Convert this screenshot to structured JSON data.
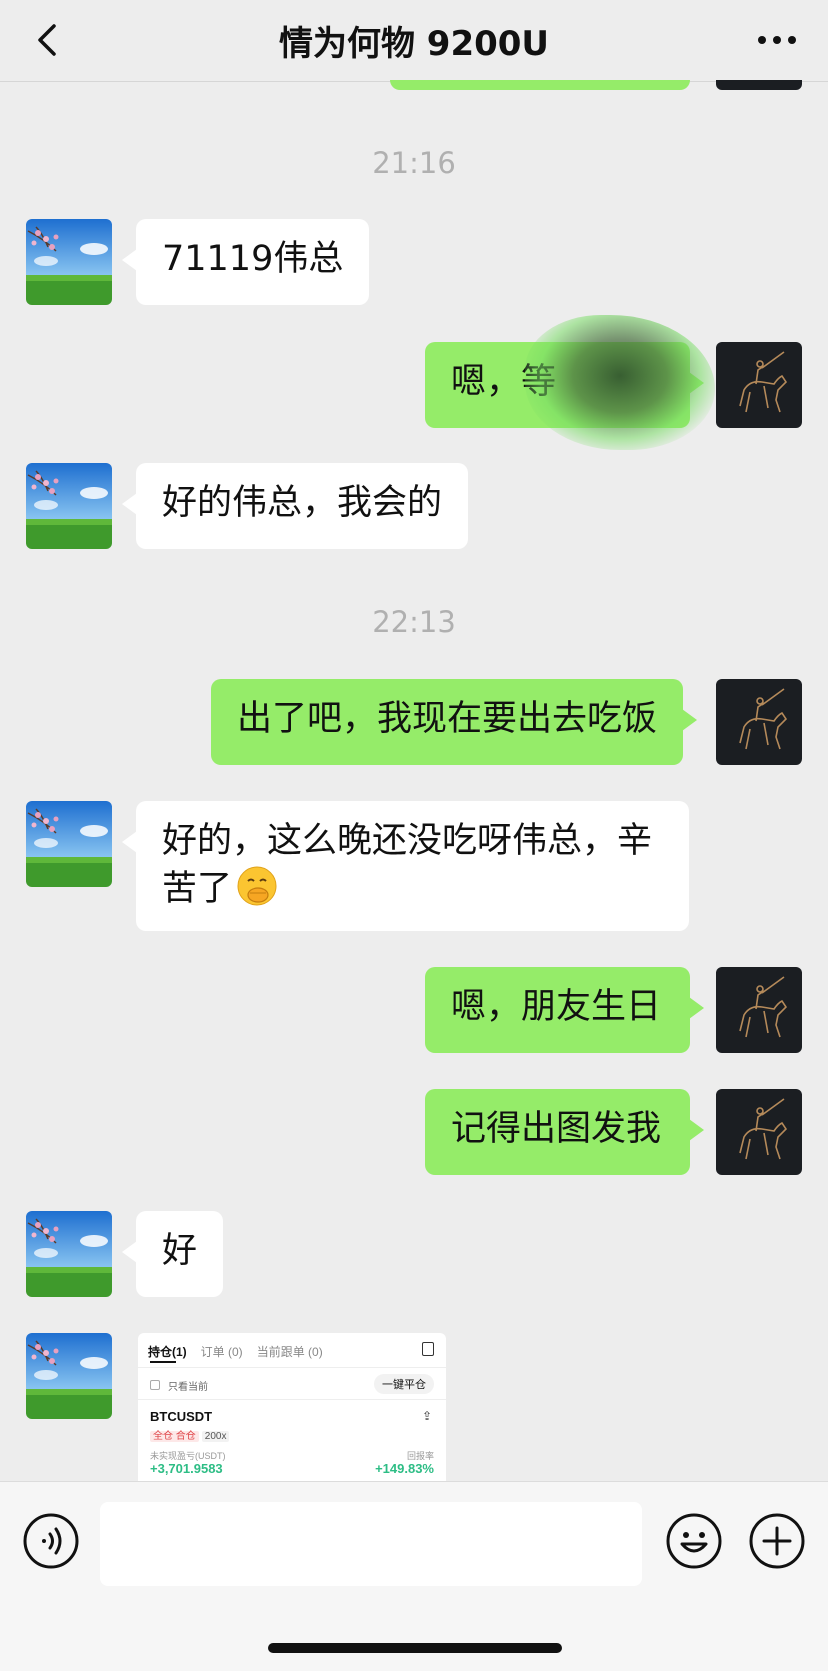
{
  "header": {
    "title": "情为何物 9200U"
  },
  "messages": [
    {
      "type": "timestamp",
      "text": "21:16"
    },
    {
      "type": "in",
      "text": "71119伟总"
    },
    {
      "type": "out",
      "text": "嗯，等"
    },
    {
      "type": "in",
      "text": "好的伟总，我会的"
    },
    {
      "type": "timestamp",
      "text": "22:13"
    },
    {
      "type": "out",
      "text": "出了吧，我现在要出去吃饭"
    },
    {
      "type": "in",
      "text_line1": "好的，这么晚还没吃呀伟总，辛",
      "text_line2": "苦了",
      "emoji": "hand-over-mouth-emoji"
    },
    {
      "type": "out",
      "text": "嗯，朋友生日"
    },
    {
      "type": "out",
      "text": "记得出图发我"
    },
    {
      "type": "in",
      "text": "好"
    },
    {
      "type": "in-image",
      "screenshot": {
        "tab_positions": "持仓(1)",
        "tab_orders": "订单 (0)",
        "tab_copy": "当前跟单 (0)",
        "only_current": "只看当前",
        "close_all": "一键平仓",
        "symbol": "BTCUSDT",
        "tag_mode": "全仓 合仓",
        "tag_leverage": "200x",
        "pnl_label": "未实现盈亏(USDT)",
        "roi_label": "回报率",
        "pnl_value": "+3,701.9583",
        "roi_value": "+149.83%"
      }
    }
  ],
  "colors": {
    "background": "#ededed",
    "outgoing_bubble": "#95ec69",
    "incoming_bubble": "#ffffff",
    "timestamp": "#b0b0b0",
    "profit": "#2dbd85"
  },
  "icons": {
    "back": "chevron-left-icon",
    "more": "more-dots-icon",
    "voice": "voice-icon",
    "emoji": "emoji-icon",
    "plus": "plus-icon"
  }
}
